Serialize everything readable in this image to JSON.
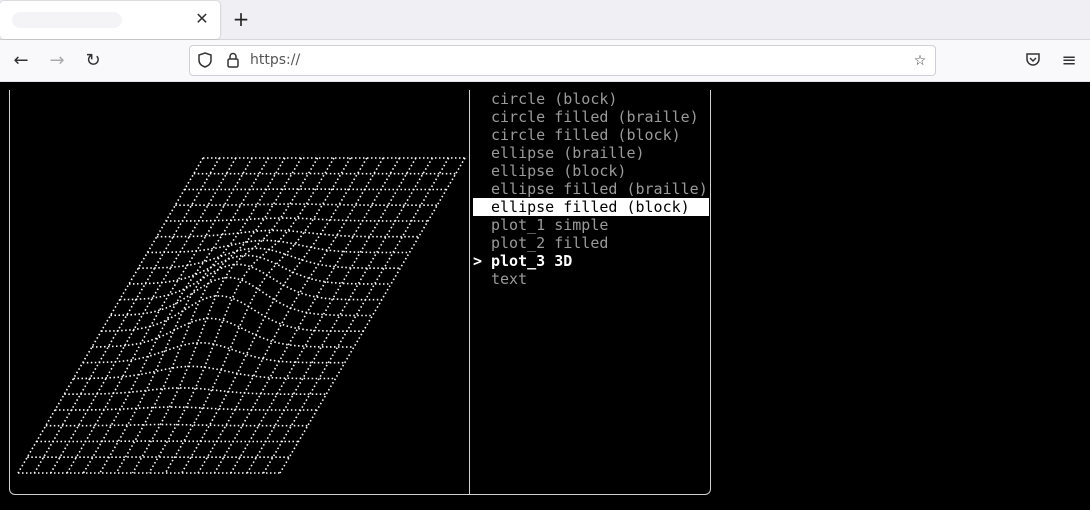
{
  "browser": {
    "tab": {
      "title": "",
      "close_icon": "close-icon"
    },
    "new_tab_label": "+",
    "url": "https://"
  },
  "menu": {
    "items": [
      {
        "label": "circle (block)",
        "state": "normal"
      },
      {
        "label": "circle filled (braille)",
        "state": "normal"
      },
      {
        "label": "circle filled (block)",
        "state": "normal"
      },
      {
        "label": "ellipse (braille)",
        "state": "normal"
      },
      {
        "label": "ellipse (block)",
        "state": "normal"
      },
      {
        "label": "ellipse filled (braille)",
        "state": "normal"
      },
      {
        "label": "ellipse filled (block)",
        "state": "selected"
      },
      {
        "label": "plot_1 simple",
        "state": "normal"
      },
      {
        "label": "plot_2 filled",
        "state": "normal"
      },
      {
        "label": "plot_3 3D",
        "state": "current"
      },
      {
        "label": "text",
        "state": "normal"
      }
    ],
    "cursor_marker": ">"
  },
  "colors": {
    "plot": "#ffffff",
    "menu_dim": "#9a9a9a",
    "selected_bg": "#ffffff"
  }
}
